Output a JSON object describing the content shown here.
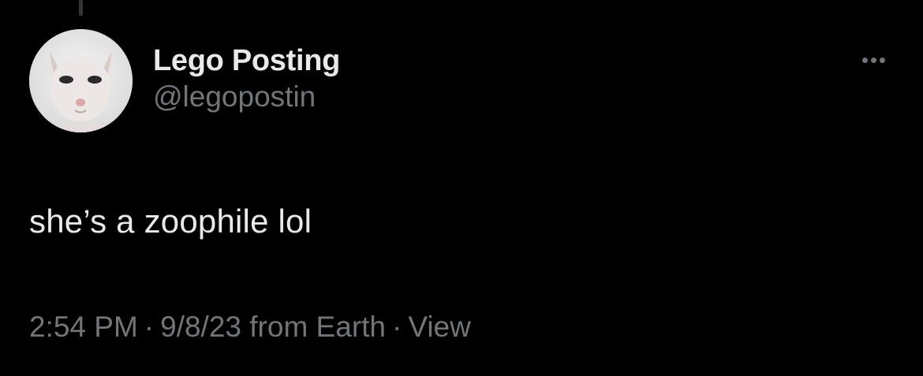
{
  "author": {
    "display_name": "Lego Posting",
    "handle": "@legopostin"
  },
  "tweet": {
    "text": "she’s a zoophile lol"
  },
  "meta": {
    "time": "2:54 PM",
    "separator": "·",
    "date": "9/8/23",
    "source": "from Earth",
    "views_label": "View"
  },
  "icons": {
    "avatar": "hairless-cat-avatar",
    "more": "more-horizontal-icon"
  },
  "colors": {
    "background": "#000000",
    "primary_text": "#e7e9ea",
    "secondary_text": "#71767b"
  }
}
